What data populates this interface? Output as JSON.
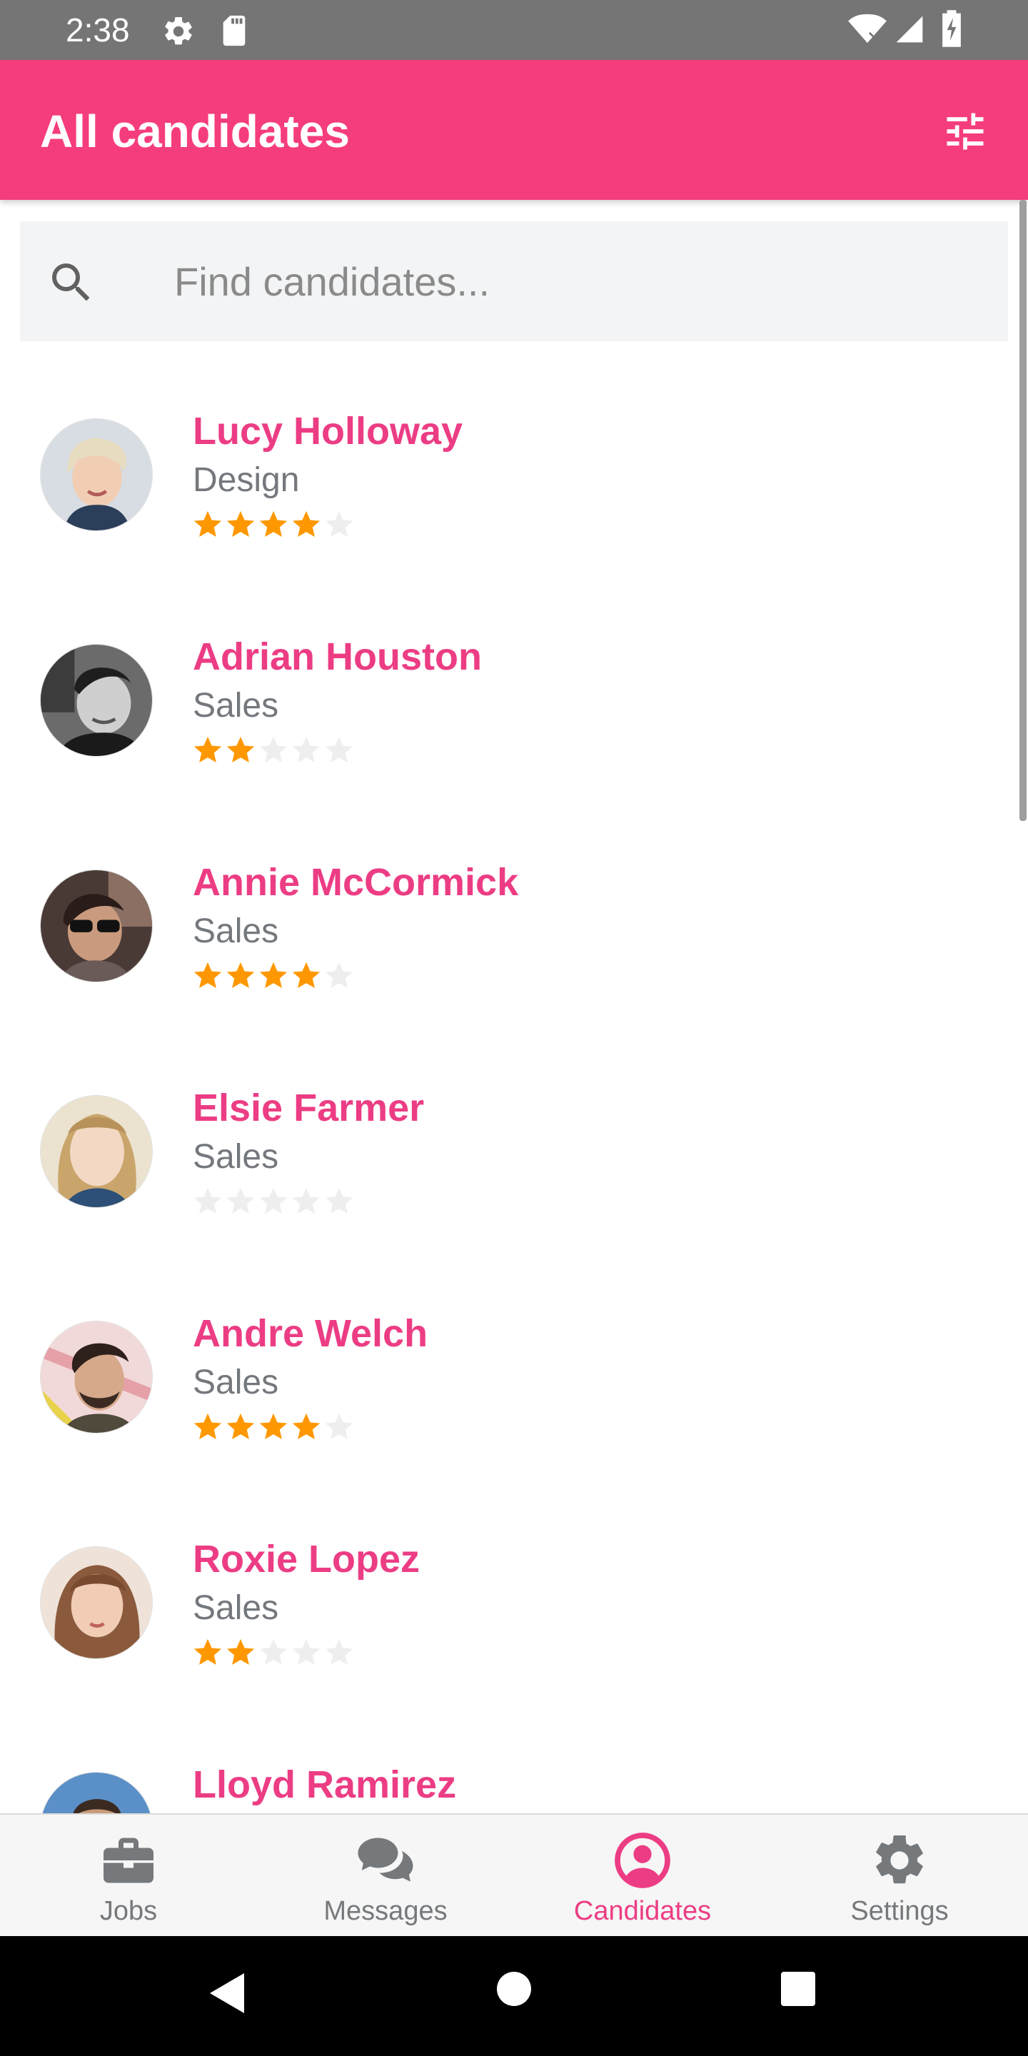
{
  "status_bar": {
    "time": "2:38",
    "icons": [
      "gear-icon",
      "sd-card-icon",
      "wifi-icon",
      "signal-icon",
      "battery-icon"
    ]
  },
  "app_bar": {
    "title": "All candidates",
    "action_icon": "tune-icon"
  },
  "search": {
    "placeholder": "Find candidates...",
    "value": "",
    "icon": "search-icon"
  },
  "candidates": [
    {
      "name": "Lucy Holloway",
      "department": "Design",
      "rating": 4,
      "rating_max": 5
    },
    {
      "name": "Adrian Houston",
      "department": "Sales",
      "rating": 2,
      "rating_max": 5
    },
    {
      "name": "Annie McCormick",
      "department": "Sales",
      "rating": 4,
      "rating_max": 5
    },
    {
      "name": "Elsie Farmer",
      "department": "Sales",
      "rating": 0,
      "rating_max": 5
    },
    {
      "name": "Andre Welch",
      "department": "Sales",
      "rating": 4,
      "rating_max": 5
    },
    {
      "name": "Roxie Lopez",
      "department": "Sales",
      "rating": 2,
      "rating_max": 5
    },
    {
      "name": "Lloyd Ramirez",
      "department": "",
      "rating": 0,
      "rating_max": 5
    }
  ],
  "bottom_nav": {
    "items": [
      {
        "label": "Jobs",
        "icon": "briefcase-icon",
        "active": false
      },
      {
        "label": "Messages",
        "icon": "chat-bubbles-icon",
        "active": false
      },
      {
        "label": "Candidates",
        "icon": "account-circle-icon",
        "active": true
      },
      {
        "label": "Settings",
        "icon": "gear-icon",
        "active": false
      }
    ]
  },
  "colors": {
    "brand": "#f53d7d",
    "name_text": "#ec3d84",
    "star_filled": "#ff9800",
    "star_empty": "#eeeeee",
    "nav_inactive": "#76797c"
  }
}
